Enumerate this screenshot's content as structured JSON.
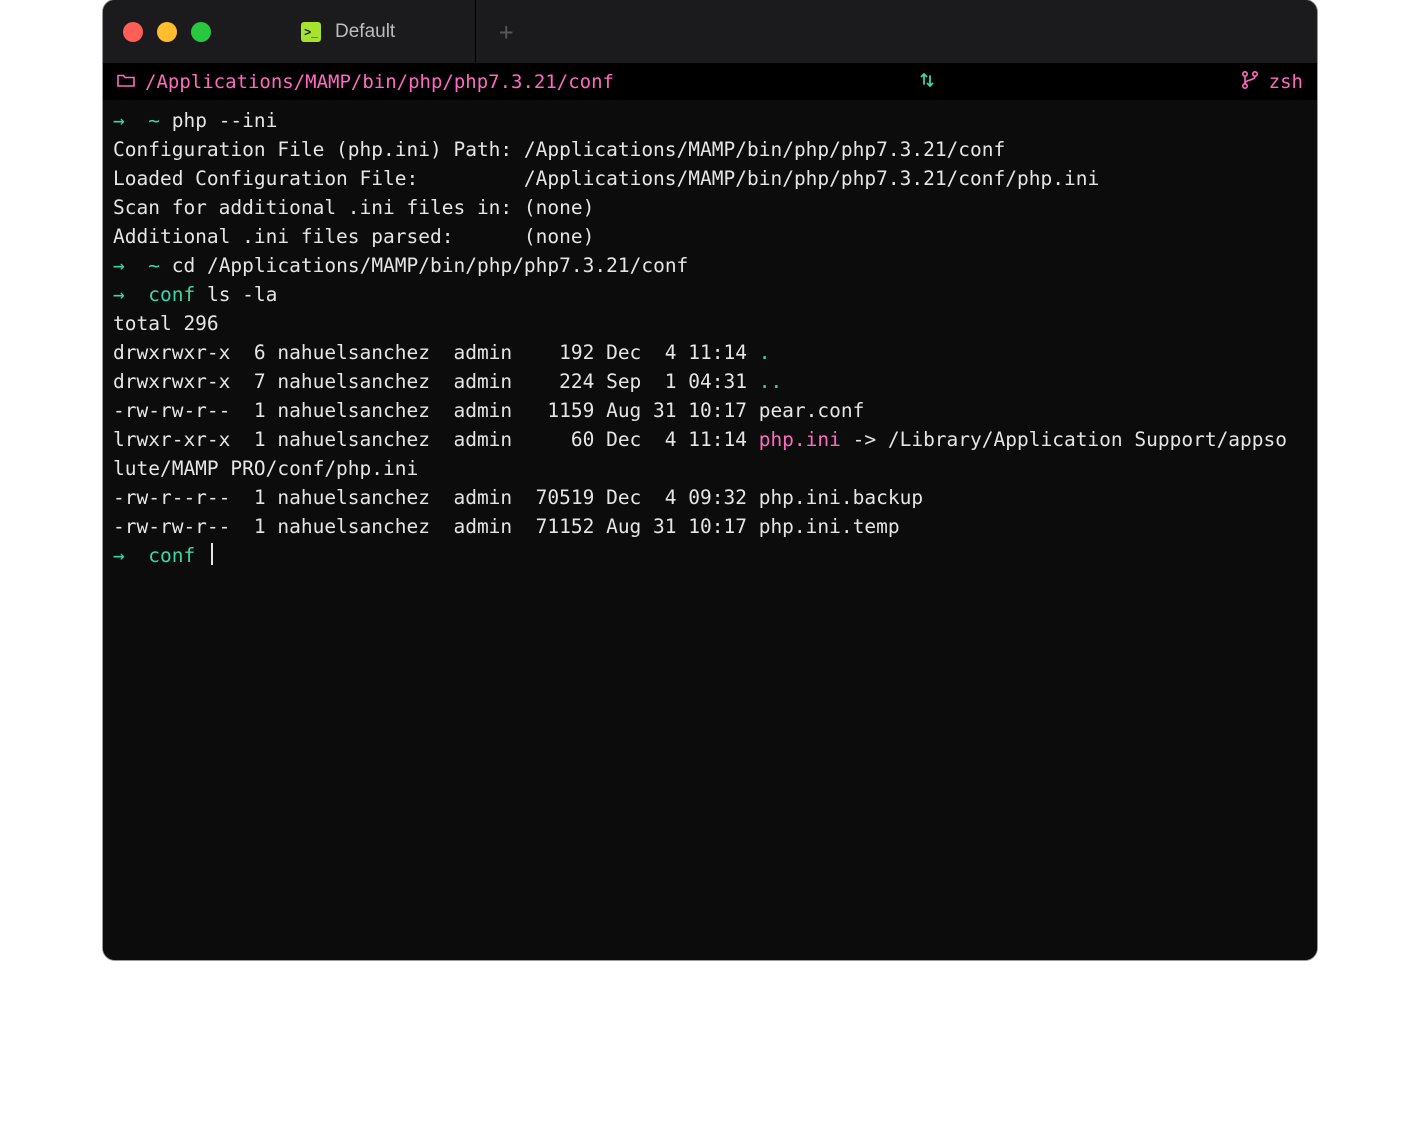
{
  "window": {
    "tab_label": "Default",
    "newtab_glyph": "+"
  },
  "pathbar": {
    "folder_glyph": "▢",
    "path": "/Applications/MAMP/bin/php/php7.3.21/conf",
    "mid_glyph": "⇵",
    "git_glyph": "⎇",
    "shell": "zsh"
  },
  "prompt": {
    "arrow": "→",
    "tilde": "~",
    "conf": "conf"
  },
  "term": {
    "cmd1": "php --ini",
    "l1_label": "Configuration File (php.ini) Path:",
    "l1_val": "/Applications/MAMP/bin/php/php7.3.21/conf",
    "l2_label": "Loaded Configuration File:",
    "l2_val": "/Applications/MAMP/bin/php/php7.3.21/conf/php.ini",
    "l3_label": "Scan for additional .ini files in:",
    "l3_val": "(none)",
    "l4_label": "Additional .ini files parsed:",
    "l4_val": "(none)",
    "cmd2": "cd /Applications/MAMP/bin/php/php7.3.21/conf",
    "cmd3": "ls -la",
    "total": "total 296",
    "row1_a": "drwxrwxr-x  6 nahuelsanchez  admin    192 Dec  4 11:14 ",
    "row1_b": ".",
    "row2_a": "drwxrwxr-x  7 nahuelsanchez  admin    224 Sep  1 04:31 ",
    "row2_b": "..",
    "row3": "-rw-rw-r--  1 nahuelsanchez  admin   1159 Aug 31 10:17 pear.conf",
    "row4_a": "lrwxr-xr-x  1 nahuelsanchez  admin     60 Dec  4 11:14 ",
    "row4_b": "php.ini",
    "row4_c": " -> /Library/Application Support/appso",
    "row4_d": "lute/MAMP PRO/conf/php.ini",
    "row5": "-rw-r--r--  1 nahuelsanchez  admin  70519 Dec  4 09:32 php.ini.backup",
    "row6": "-rw-rw-r--  1 nahuelsanchez  admin  71152 Aug 31 10:17 php.ini.temp"
  }
}
